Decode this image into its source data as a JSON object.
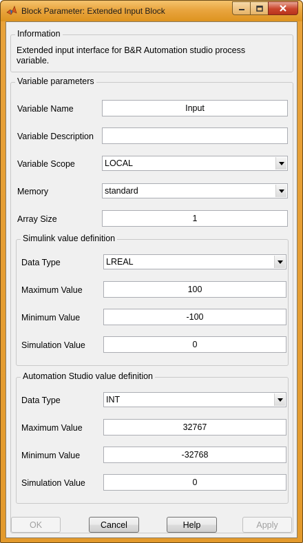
{
  "window": {
    "title": "Block Parameter: Extended Input Block"
  },
  "information": {
    "legend": "Information",
    "text": "Extended input interface for B&R Automation studio process variable."
  },
  "variable_parameters": {
    "legend": "Variable parameters",
    "name_label": "Variable Name",
    "name_value": "Input",
    "description_label": "Variable Description",
    "description_value": "",
    "scope_label": "Variable Scope",
    "scope_value": "LOCAL",
    "memory_label": "Memory",
    "memory_value": "standard",
    "array_label": "Array Size",
    "array_value": "1"
  },
  "simulink": {
    "legend": "Simulink value definition",
    "datatype_label": "Data Type",
    "datatype_value": "LREAL",
    "max_label": "Maximum Value",
    "max_value": "100",
    "min_label": "Minimum Value",
    "min_value": "-100",
    "sim_label": "Simulation Value",
    "sim_value": "0"
  },
  "automation_studio": {
    "legend": "Automation Studio value definition",
    "datatype_label": "Data Type",
    "datatype_value": "INT",
    "max_label": "Maximum Value",
    "max_value": "32767",
    "min_label": "Minimum Value",
    "min_value": "-32768",
    "sim_label": "Simulation Value",
    "sim_value": "0"
  },
  "buttons": {
    "ok": "OK",
    "cancel": "Cancel",
    "help": "Help",
    "apply": "Apply"
  },
  "icons": {
    "app": "matlab-logo-icon",
    "dropdown": "chevron-down-icon"
  },
  "colors": {
    "title_bar": "#e9a53f",
    "close_button": "#c9452c",
    "dialog_bg": "#f0f0f0"
  }
}
